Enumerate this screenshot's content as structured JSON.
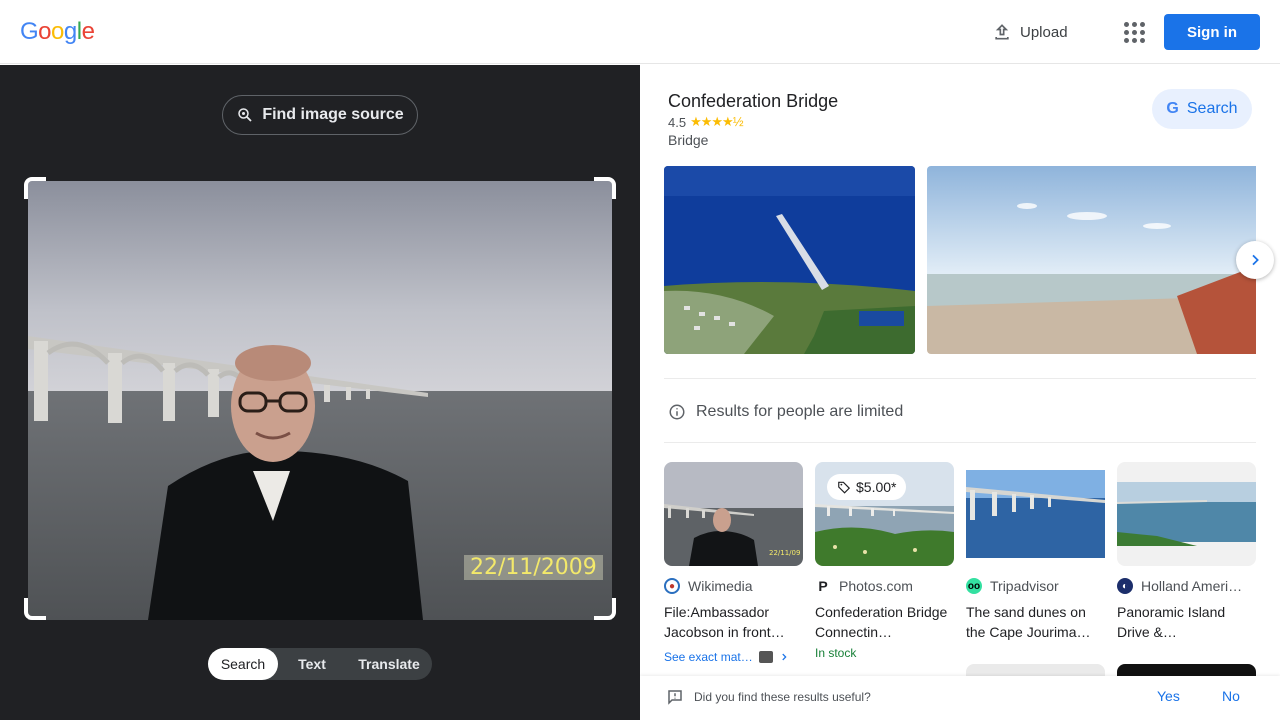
{
  "header": {
    "logo_letters": [
      "G",
      "o",
      "o",
      "g",
      "l",
      "e"
    ],
    "logo_colors": [
      "#4285f4",
      "#ea4335",
      "#fbbc05",
      "#4285f4",
      "#34a853",
      "#ea4335"
    ],
    "upload_label": "Upload",
    "apps_icon": "apps-grid-icon",
    "signin_label": "Sign in"
  },
  "left_panel": {
    "find_source_label": "Find image source",
    "photo_datestamp": "22/11/2009",
    "modes": [
      "Search",
      "Text",
      "Translate"
    ],
    "active_mode": "Search"
  },
  "knowledge_panel": {
    "title": "Confederation Bridge",
    "rating": "4.5",
    "stars": "★★★★½",
    "type": "Bridge",
    "search_button_label": "Search"
  },
  "notice": "Results for people are limited",
  "results": [
    {
      "source": "Wikimedia",
      "title": "File:Ambassador Jacobson in front…",
      "extra": "See exact mat…",
      "icon_color": "#2a6fbf"
    },
    {
      "source": "Photos.com",
      "title": "Confederation Bridge Connectin…",
      "price": "$5.00*",
      "stock": "In stock",
      "icon_color": "#202124"
    },
    {
      "source": "Tripadvisor",
      "title": "The sand dunes on the Cape Jourima…",
      "icon_color": "#34e0a1"
    },
    {
      "source": "Holland Ameri…",
      "title": "Panoramic Island Drive &…",
      "icon_color": "#1c2e6b"
    }
  ],
  "feedback": {
    "question": "Did you find these results useful?",
    "yes": "Yes",
    "no": "No"
  },
  "colors": {
    "accent": "#1a73e8",
    "dark_bg": "#202124",
    "star": "#fbbc04"
  }
}
